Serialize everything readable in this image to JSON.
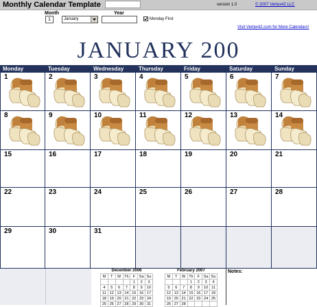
{
  "header": {
    "app_title": "Monthly Calendar Template",
    "version": "version 1.0",
    "copyright": "© 2007 Vertex42 LLC"
  },
  "controls": {
    "month_label": "Month",
    "month_number": "1",
    "month_name": "January",
    "year_label": "Year",
    "year_value": "",
    "monday_first_label": "Monday First",
    "monday_first_checked": true,
    "more_calendars_link": "Visit Vertex42.com for More Calendars!"
  },
  "calendar": {
    "title": "JANUARY  200",
    "weekdays": [
      "Monday",
      "Tuesday",
      "Wednesday",
      "Thursday",
      "Friday",
      "Saturday",
      "Sunday"
    ],
    "weeks": [
      [
        "1",
        "2",
        "3",
        "4",
        "5",
        "6",
        "7"
      ],
      [
        "8",
        "9",
        "10",
        "11",
        "12",
        "13",
        "14"
      ],
      [
        "15",
        "16",
        "17",
        "18",
        "19",
        "20",
        "21"
      ],
      [
        "22",
        "23",
        "24",
        "25",
        "26",
        "27",
        "28"
      ],
      [
        "29",
        "30",
        "31",
        "",
        "",
        "",
        ""
      ]
    ],
    "bread_icon": "bread-loaf-icon",
    "header_color": "#22325c",
    "empty_cell_color": "#ecedf3"
  },
  "mini_calendars": [
    {
      "title": "December 2006",
      "headers": [
        "M",
        "T",
        "W",
        "Th",
        "F",
        "Sa",
        "Su"
      ],
      "rows": [
        [
          "",
          "",
          "",
          "",
          "1",
          "2",
          "3"
        ],
        [
          "4",
          "5",
          "6",
          "7",
          "8",
          "9",
          "10"
        ],
        [
          "11",
          "12",
          "13",
          "14",
          "15",
          "16",
          "17"
        ],
        [
          "18",
          "19",
          "20",
          "21",
          "22",
          "23",
          "24"
        ],
        [
          "25",
          "26",
          "27",
          "28",
          "29",
          "30",
          "31"
        ]
      ]
    },
    {
      "title": "February 2007",
      "headers": [
        "M",
        "T",
        "W",
        "Th",
        "F",
        "Sa",
        "Su"
      ],
      "rows": [
        [
          "",
          "",
          "",
          "1",
          "2",
          "3",
          "4"
        ],
        [
          "5",
          "6",
          "7",
          "8",
          "9",
          "10",
          "11"
        ],
        [
          "12",
          "13",
          "14",
          "15",
          "16",
          "17",
          "18"
        ],
        [
          "19",
          "20",
          "21",
          "22",
          "23",
          "24",
          "25"
        ],
        [
          "26",
          "27",
          "28",
          "",
          "",
          "",
          ""
        ]
      ]
    }
  ],
  "notes": {
    "label": "Notes:"
  }
}
